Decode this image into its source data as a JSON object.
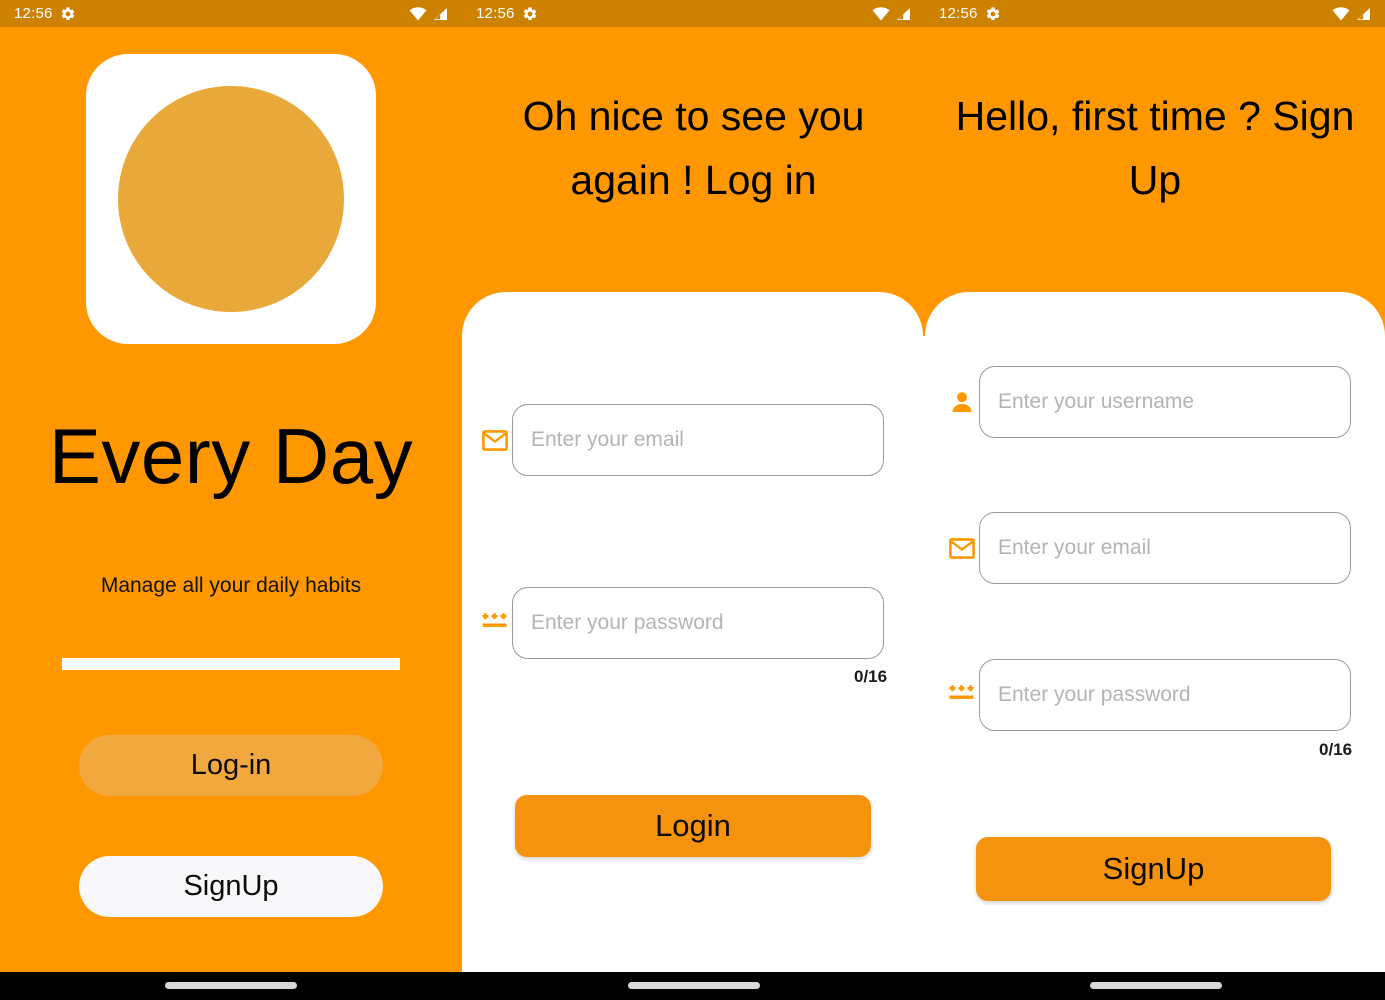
{
  "statusbars": [
    {
      "time": "12:56",
      "gear_icon": "gear-icon",
      "wifi_icon": "wifi-icon",
      "signal_icon": "signal-icon"
    },
    {
      "time": "12:56",
      "gear_icon": "gear-icon",
      "wifi_icon": "wifi-icon",
      "signal_icon": "signal-icon"
    },
    {
      "time": "12:56",
      "gear_icon": "gear-icon",
      "wifi_icon": "wifi-icon",
      "signal_icon": "signal-icon"
    }
  ],
  "colors": {
    "brand_orange": "#ff9800",
    "statusbar_orange": "#cc8100",
    "logo_circle": "#e8a93a",
    "cta_orange": "#f5920e",
    "login_pill": "#f0a83f",
    "signup_pill": "#f8f8fa",
    "icon_orange": "#ff9800",
    "input_border": "#9a9a9a",
    "placeholder": "#b4b4b4"
  },
  "welcome": {
    "logo_icon": "app-logo-icon",
    "title": "Every Day",
    "subtitle": "Manage all your daily habits",
    "login_button": "Log-in",
    "signup_button": "SignUp"
  },
  "login_screen": {
    "heading": "Oh nice to see you again ! Log in",
    "fields": [
      {
        "name": "email",
        "icon": "envelope-icon",
        "placeholder": "Enter your email",
        "value": ""
      },
      {
        "name": "password",
        "icon": "password-asterisks-icon",
        "placeholder": "Enter your password",
        "value": "",
        "counter": "0/16"
      }
    ],
    "submit_button": "Login"
  },
  "signup_screen": {
    "heading": "Hello, first time ? Sign Up",
    "fields": [
      {
        "name": "username",
        "icon": "person-icon",
        "placeholder": "Enter your username",
        "value": ""
      },
      {
        "name": "email",
        "icon": "envelope-icon",
        "placeholder": "Enter your email",
        "value": ""
      },
      {
        "name": "password",
        "icon": "password-asterisks-icon",
        "placeholder": "Enter your password",
        "value": "",
        "counter": "0/16"
      }
    ],
    "submit_button": "SignUp"
  },
  "navbar": {
    "gesture_bar_icon": "gesture-bar-icon",
    "count": 3
  }
}
